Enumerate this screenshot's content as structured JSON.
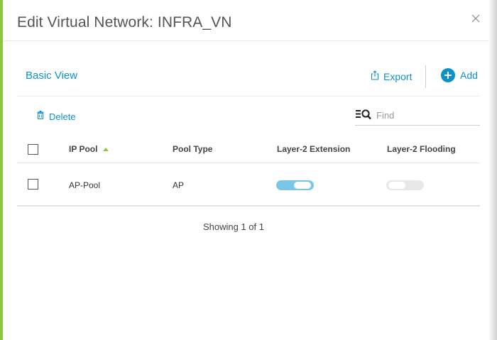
{
  "modal": {
    "title": "Edit Virtual Network: INFRA_VN",
    "close_icon": "close-icon"
  },
  "toolbar": {
    "view_label": "Basic View",
    "export_label": "Export",
    "add_label": "Add",
    "delete_label": "Delete",
    "find_placeholder": "Find",
    "find_value": ""
  },
  "table": {
    "columns": [
      "IP Pool",
      "Pool Type",
      "Layer-2 Extension",
      "Layer-2 Flooding"
    ],
    "sort_column": "IP Pool",
    "sort_direction": "ascending",
    "rows": [
      {
        "ip_pool": "AP-Pool",
        "pool_type": "AP",
        "layer2_extension": true,
        "layer2_flooding": false
      }
    ]
  },
  "pagination": {
    "summary": "Showing 1 of 1"
  },
  "colors": {
    "accent": "#0d91c9",
    "sort_arrow": "#8cc63f",
    "left_accent": "#8cc63f",
    "toggle_on": "#79c6e6",
    "toggle_off": "#e8e8e8"
  }
}
